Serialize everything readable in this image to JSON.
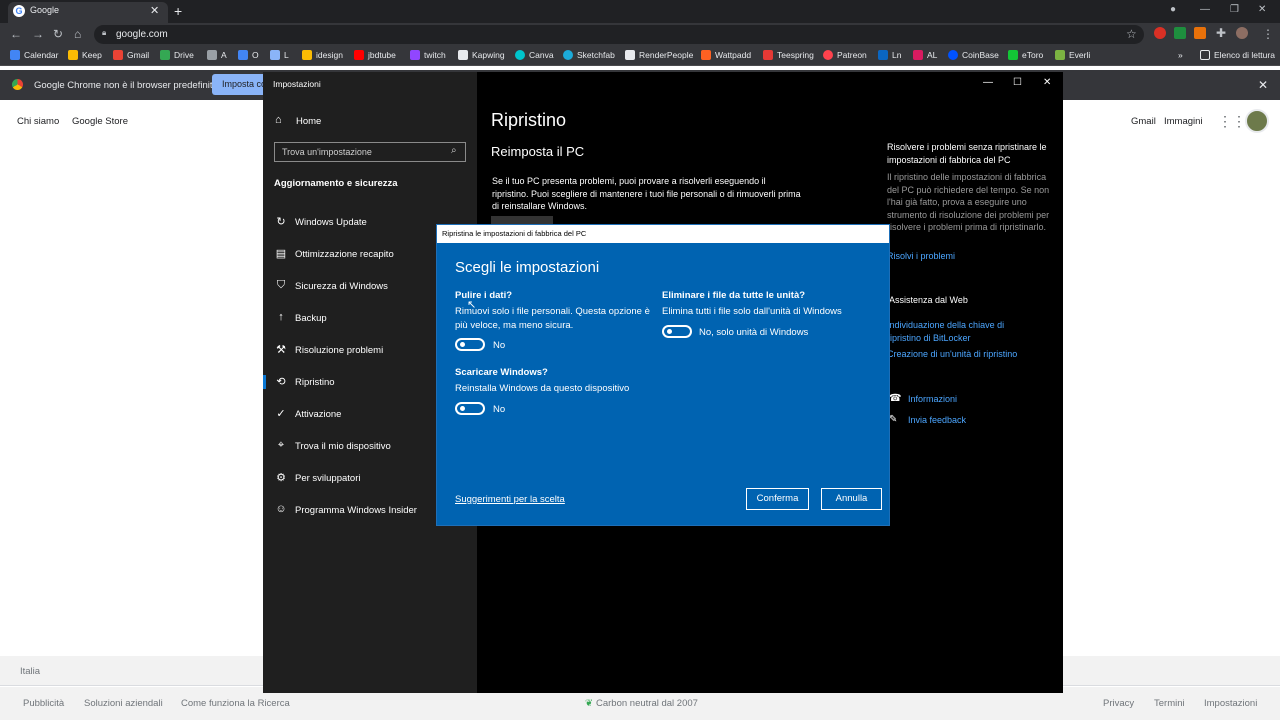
{
  "browser": {
    "tab_title": "Google",
    "url": "google.com",
    "bookmarks": [
      "Calendar",
      "Keep",
      "Gmail",
      "Drive",
      "A",
      "O",
      "L",
      "idesign",
      "jbdtube",
      "twitch",
      "Kapwing",
      "Canva",
      "Sketchfab",
      "RenderPeople",
      "Wattpadd",
      "Teespring",
      "Patreon",
      "Ln",
      "AL",
      "CoinBase",
      "eToro",
      "Everli"
    ],
    "reading_list": "Elenco di lettura",
    "infobar_text": "Google Chrome non è il browser predefinito",
    "infobar_button": "Imposta come predefinito"
  },
  "google": {
    "top_left": [
      "Chi siamo",
      "Google Store"
    ],
    "top_right": [
      "Gmail",
      "Immagini"
    ],
    "country": "Italia",
    "footer_left": [
      "Pubblicità",
      "Soluzioni aziendali",
      "Come funziona la Ricerca"
    ],
    "footer_center": "Carbon neutral dal 2007",
    "footer_right": [
      "Privacy",
      "Termini",
      "Impostazioni"
    ]
  },
  "settings": {
    "window_title": "Impostazioni",
    "home": "Home",
    "search_placeholder": "Trova un'impostazione",
    "section": "Aggiornamento e sicurezza",
    "nav": [
      "Windows Update",
      "Ottimizzazione recapito",
      "Sicurezza di Windows",
      "Backup",
      "Risoluzione problemi",
      "Ripristino",
      "Attivazione",
      "Trova il mio dispositivo",
      "Per sviluppatori",
      "Programma Windows Insider"
    ],
    "selected": "Ripristino",
    "page_title": "Ripristino",
    "section_title": "Reimposta il PC",
    "description": "Se il tuo PC presenta problemi, puoi provare a risolverli eseguendo il ripristino. Puoi scegliere di mantenere i tuoi file personali o di rimuoverli prima di reinstallare Windows.",
    "right_heading": "Risolvere i problemi senza ripristinare le impostazioni di fabbrica del PC",
    "right_text": "Il ripristino delle impostazioni di fabbrica del PC può richiedere del tempo. Se non l'hai già fatto, prova a eseguire uno strumento di risoluzione dei problemi per risolvere i problemi prima di ripristinarlo.",
    "right_link": "Risolvi i problemi",
    "web_help": "Assistenza dal Web",
    "web_links": [
      "Individuazione della chiave di ripristino di BitLocker",
      "Creazione di un'unità di ripristino"
    ],
    "info": "Informazioni",
    "feedback": "Invia feedback"
  },
  "dialog": {
    "title": "Ripristina le impostazioni di fabbrica del PC",
    "heading": "Scegli le impostazioni",
    "opt1_q": "Pulire i dati?",
    "opt1_d": "Rimuovi solo i file personali. Questa opzione è più veloce, ma meno sicura.",
    "opt1_v": "No",
    "opt2_q": "Eliminare i file da tutte le unità?",
    "opt2_d": "Elimina tutti i file solo dall'unità di Windows",
    "opt2_v": "No, solo unità di Windows",
    "opt3_q": "Scaricare Windows?",
    "opt3_d": "Reinstalla Windows da questo dispositivo",
    "opt3_v": "No",
    "link": "Suggerimenti per la scelta",
    "confirm": "Conferma",
    "cancel": "Annulla"
  }
}
